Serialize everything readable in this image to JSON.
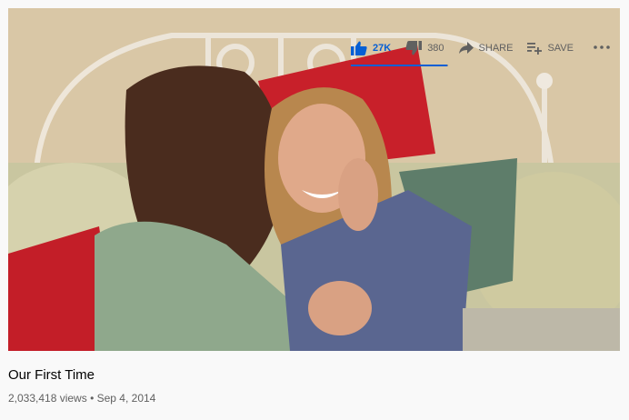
{
  "video": {
    "title": "Our First Time",
    "views": "2,033,418 views",
    "separator": "•",
    "date": "Sep 4, 2014"
  },
  "actions": {
    "like_count": "27K",
    "dislike_count": "380",
    "share_label": "SHARE",
    "save_label": "SAVE",
    "like_ratio": 0.986
  },
  "icons": {
    "like": "thumbs-up-icon",
    "dislike": "thumbs-down-icon",
    "share": "share-arrow-icon",
    "save": "add-to-playlist-icon",
    "more": "more-horizontal-icon"
  },
  "colors": {
    "accent": "#065fd4",
    "text_primary": "#030303",
    "text_secondary": "#606060",
    "background": "#f9f9f9"
  }
}
